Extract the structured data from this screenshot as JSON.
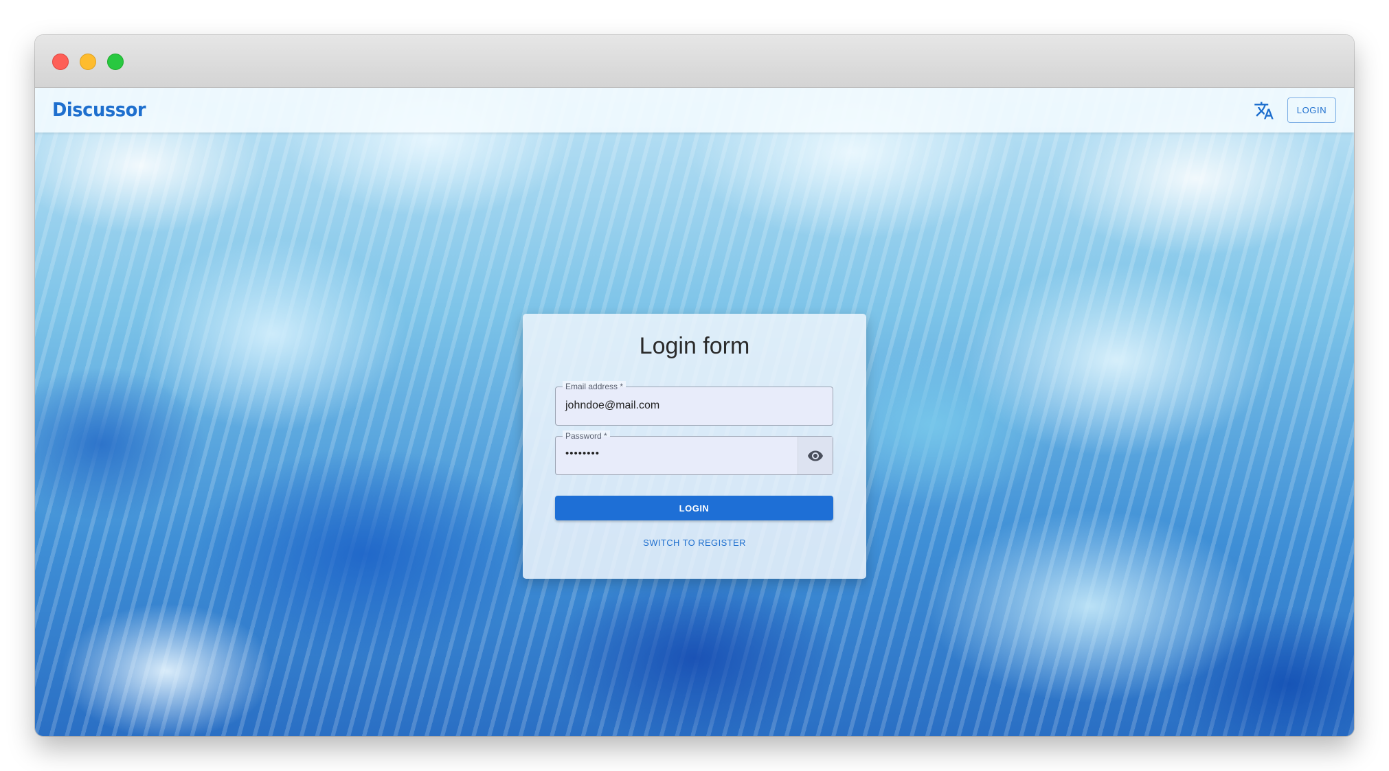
{
  "window": {
    "controls": [
      "close",
      "minimize",
      "maximize"
    ]
  },
  "header": {
    "brand": "Discussor",
    "translate_icon": "translate-icon",
    "login_label": "LOGIN"
  },
  "login_form": {
    "title": "Login form",
    "email": {
      "label": "Email address *",
      "value": "johndoe@mail.com"
    },
    "password": {
      "label": "Password *",
      "value": "••••••••",
      "toggle_icon": "eye-icon"
    },
    "submit_label": "LOGIN",
    "switch_label": "SWITCH TO REGISTER"
  },
  "colors": {
    "accent": "#1e6fd6",
    "brand": "#1e6fce"
  }
}
